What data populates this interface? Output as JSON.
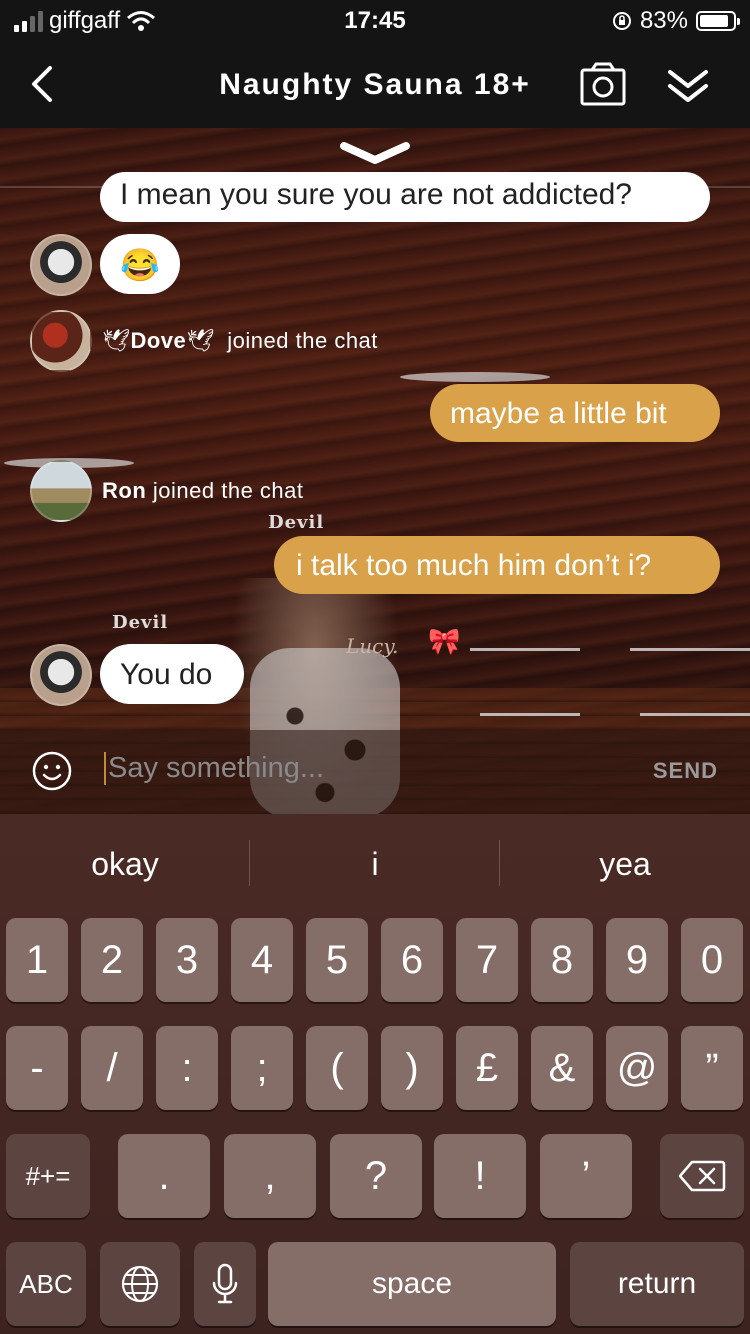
{
  "status": {
    "carrier": "giffgaff",
    "time": "17:45",
    "battery": "83%"
  },
  "nav": {
    "title": "Naughty Sauna 18+"
  },
  "messages": {
    "partial": "I mean you sure you are not addicted?",
    "emoji_msg": "😂",
    "dove_name": "Dove",
    "dove_action": "joined the chat",
    "mine1": "maybe a little bit",
    "ron_name": "Ron",
    "ron_action": "joined the chat",
    "devil_tag1": "Devil",
    "mine2": "i talk too much him don’t i?",
    "devil_tag2": "Devil",
    "lucy_tag": "Lucy.",
    "reply": "You do"
  },
  "input": {
    "placeholder": "Say something...",
    "send": "SEND"
  },
  "keyboard": {
    "suggestions": [
      "okay",
      "i",
      "yea"
    ],
    "row1": [
      "1",
      "2",
      "3",
      "4",
      "5",
      "6",
      "7",
      "8",
      "9",
      "0"
    ],
    "row2": [
      "-",
      "/",
      ":",
      ";",
      "(",
      ")",
      "£",
      "&",
      "@",
      "”"
    ],
    "row3_left": "#+=",
    "row3": [
      ".",
      ",",
      "?",
      "!",
      "’"
    ],
    "abc": "ABC",
    "space": "space",
    "return": "return"
  }
}
